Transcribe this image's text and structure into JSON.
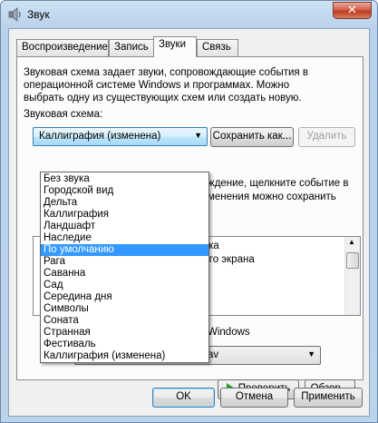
{
  "window": {
    "title": "Звук",
    "close_glyph": "✕"
  },
  "tabs": [
    "Воспроизведение",
    "Запись",
    "Звуки",
    "Связь"
  ],
  "active_tab": "Звуки",
  "description": "Звуковая схема задает звуки, сопровождающие события в операционной системе Windows и программах. Можно выбрать одну из существующих схем или создать новую.",
  "scheme": {
    "label": "Звуковая схема:",
    "selected": "Каллиграфия (изменена)",
    "save_as": "Сохранить как...",
    "delete": "Удалить",
    "options": [
      "Без звука",
      "Городской вид",
      "Дельта",
      "Каллиграфия",
      "Ландшафт",
      "Наследие",
      "По умолчанию",
      "Рага",
      "Саванна",
      "Сад",
      "Середина дня",
      "Символы",
      "Соната",
      "Странная",
      "Фестиваль",
      "Каллиграфия (изменена)"
    ],
    "highlighted": "По умолчанию"
  },
  "partial_text": {
    "events_line1": "ждение, щелкните событие в",
    "events_line2": "менения можно сохранить",
    "list_item1": "ачка",
    "list_item2": "ного экрана",
    "startup": "Windows",
    "sound_value": "av"
  },
  "buttons": {
    "test": "Проверить",
    "browse": "Обзор...",
    "ok": "OK",
    "cancel": "Отмена",
    "apply": "Применить"
  },
  "icons": {
    "dropdown_arrow": "▼",
    "scroll_up": "▲"
  }
}
